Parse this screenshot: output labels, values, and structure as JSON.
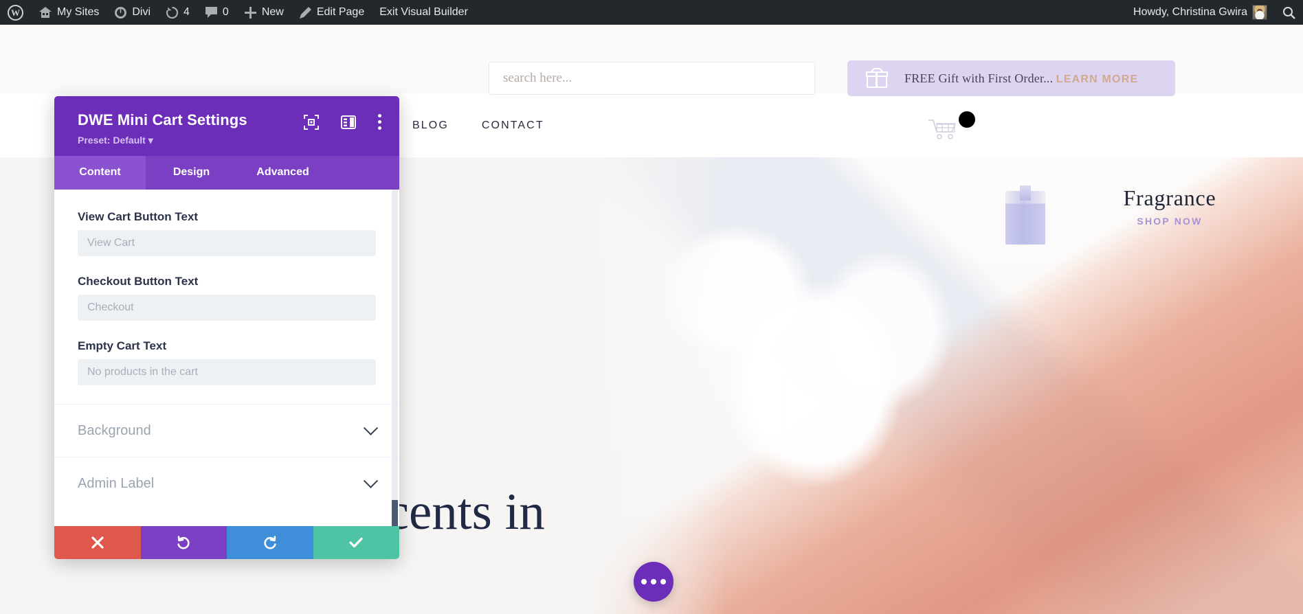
{
  "admin_bar": {
    "items": [
      {
        "label": "",
        "icon": "wordpress-logo-icon"
      },
      {
        "label": "My Sites",
        "icon": "sites-icon"
      },
      {
        "label": "Divi",
        "icon": "divi-icon"
      },
      {
        "label": "4",
        "icon": "updates-icon"
      },
      {
        "label": "0",
        "icon": "comments-icon"
      },
      {
        "label": "New",
        "icon": "plus-icon"
      },
      {
        "label": "Edit Page",
        "icon": "pencil-icon"
      },
      {
        "label": "Exit Visual Builder",
        "icon": ""
      }
    ],
    "howdy": "Howdy, Christina Gwira",
    "search_icon": "search-icon",
    "avatar": "avatar"
  },
  "site_header": {
    "search_placeholder": "search here...",
    "gift_banner": {
      "icon": "gift-icon",
      "text": "FREE Gift with First Order...",
      "link_label": "LEARN MORE",
      "background": "#ddd4f2",
      "link_color": "#d0a98e"
    },
    "nav_links": [
      "BLOG",
      "CONTACT"
    ],
    "cart_icon": "shopping-cart-icon",
    "brand_title": "Fragrance",
    "brand_sub": "SHOP NOW",
    "brand_sub_color": "#a493d6"
  },
  "hero": {
    "title": "Scents in",
    "title_color": "#212a44",
    "background": "#f6f5f4"
  },
  "fab": {
    "icon": "ellipsis-icon",
    "color": "#6c2eb9"
  },
  "modal": {
    "title": "DWE Mini Cart Settings",
    "preset_label": "Preset: Default",
    "accent": "#6c2eb9",
    "header_icons": [
      {
        "name": "focus-mode-icon"
      },
      {
        "name": "panel-layout-icon"
      },
      {
        "name": "more-options-icon"
      }
    ],
    "tabs": [
      {
        "label": "Content",
        "active": true
      },
      {
        "label": "Design",
        "active": false
      },
      {
        "label": "Advanced",
        "active": false
      }
    ],
    "fields": [
      {
        "label": "View Cart Button Text",
        "value": "",
        "placeholder": "View Cart"
      },
      {
        "label": "Checkout Button Text",
        "value": "",
        "placeholder": "Checkout"
      },
      {
        "label": "Empty Cart Text",
        "value": "",
        "placeholder": "No products in the cart"
      }
    ],
    "accordions": [
      {
        "label": "Background",
        "icon": "chevron-down-icon"
      },
      {
        "label": "Admin Label",
        "icon": "chevron-down-icon"
      }
    ],
    "footer_buttons": [
      {
        "name": "discard-button",
        "icon": "close-icon",
        "color": "#e0574b"
      },
      {
        "name": "undo-button",
        "icon": "undo-icon",
        "color": "#7b3fc4"
      },
      {
        "name": "redo-button",
        "icon": "redo-icon",
        "color": "#3e8ed9"
      },
      {
        "name": "save-button",
        "icon": "check-icon",
        "color": "#4fc4a4"
      }
    ]
  }
}
